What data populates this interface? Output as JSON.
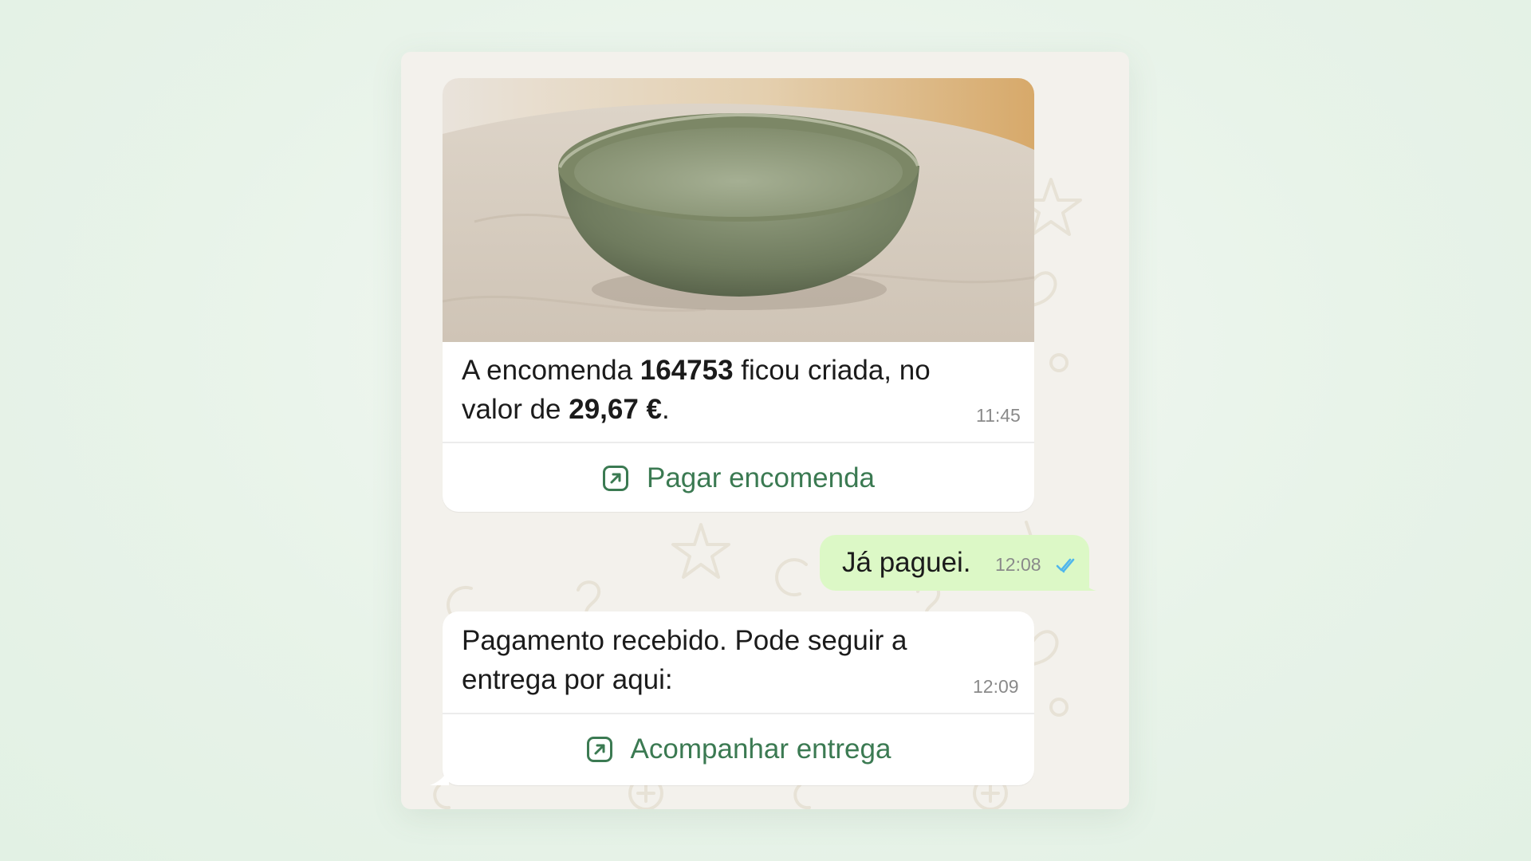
{
  "messages": [
    {
      "direction": "incoming",
      "text_parts": [
        "A encomenda ",
        "164753",
        " ficou criada, no",
        "valor de ",
        "29,67 €",
        "."
      ],
      "time": "11:45",
      "action_label": "Pagar encomenda",
      "action_icon": "external-link-icon",
      "image": "green ceramic bowl on linen cloth"
    },
    {
      "direction": "outgoing",
      "text": "Já paguei.",
      "time": "12:08",
      "status_icon": "double-check-icon"
    },
    {
      "direction": "incoming",
      "lines": [
        "Pagamento recebido. Pode seguir a",
        "entrega por aqui:"
      ],
      "time": "12:09",
      "action_label": "Acompanhar entrega",
      "action_icon": "external-link-icon"
    }
  ],
  "colors": {
    "accent_green": "#3b7a52",
    "outgoing_bubble": "#dcf8c6",
    "chat_background": "#f3f1ec",
    "read_ticks": "#4fb6ec"
  }
}
